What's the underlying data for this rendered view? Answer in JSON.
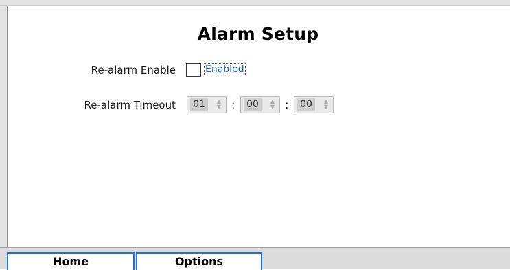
{
  "header": {
    "title": "Alarm Setup"
  },
  "form": {
    "realarm_enable": {
      "label": "Re-alarm Enable",
      "checkbox_text": "Enabled",
      "checked": false
    },
    "realarm_timeout": {
      "label": "Re-alarm Timeout",
      "hours": "01",
      "minutes": "00",
      "seconds": "00",
      "separator": ":"
    }
  },
  "nav": {
    "home_label": "Home",
    "options_label": "Options"
  },
  "icons": {
    "spin_up": "chevron-up-icon",
    "spin_down": "chevron-down-icon"
  },
  "colors": {
    "accent": "#1f73d6",
    "link_text": "#1a5fb4"
  }
}
